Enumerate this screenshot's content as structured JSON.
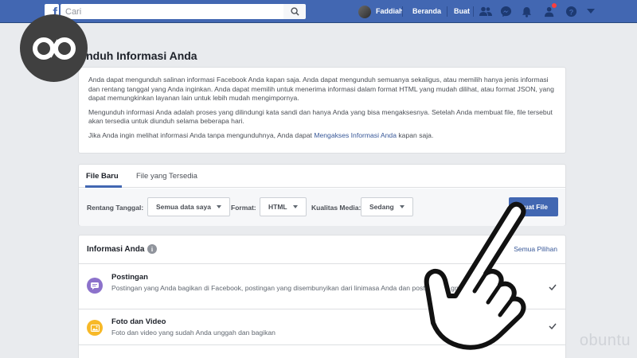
{
  "topbar": {
    "logo_letter": "f",
    "search_placeholder": "Cari",
    "user_name": "Faddiah",
    "home_label": "Beranda",
    "create_label": "Buat"
  },
  "watermark": {
    "text": "obuntu"
  },
  "page": {
    "title": "Unduh Informasi Anda"
  },
  "intro": {
    "para1": "Anda dapat mengunduh salinan informasi Facebook Anda kapan saja. Anda dapat mengunduh semuanya sekaligus, atau memilih hanya jenis informasi dan rentang tanggal yang Anda inginkan. Anda dapat memilih untuk menerima informasi dalam format HTML yang mudah dilihat, atau format JSON, yang dapat memungkinkan layanan lain untuk lebih mudah mengimpornya.",
    "para2": "Mengunduh informasi Anda adalah proses yang dilindungi kata sandi dan hanya Anda yang bisa mengaksesnya. Setelah Anda membuat file, file tersebut akan tersedia untuk diunduh selama beberapa hari.",
    "para3_before": "Jika Anda ingin melihat informasi Anda tanpa mengunduhnya, Anda dapat ",
    "para3_link": "Mengakses Informasi Anda",
    "para3_after": " kapan saja."
  },
  "tabs": [
    {
      "label": "File Baru",
      "active": true
    },
    {
      "label": "File yang Tersedia",
      "active": false
    }
  ],
  "options": {
    "date_range_label": "Rentang Tanggal:",
    "date_range_value": "Semua data saya",
    "format_label": "Format:",
    "format_value": "HTML",
    "media_quality_label": "Kualitas Media:",
    "media_quality_value": "Sedang",
    "create_button": "Buat File"
  },
  "info_list": {
    "title": "Informasi Anda",
    "select_all": "Semua Pilihan",
    "items": [
      {
        "title": "Postingan",
        "description": "Postingan yang Anda bagikan di Facebook, postingan yang disembunyikan dari linimasa Anda dan postingan di grup yang Anda buat",
        "icon": "post-icon",
        "icon_color": "#8c72cb",
        "checked": true
      },
      {
        "title": "Foto dan Video",
        "description": "Foto dan video yang sudah Anda unggah dan bagikan",
        "icon": "photo-icon",
        "icon_color": "#f7b928",
        "checked": true
      }
    ]
  },
  "colors": {
    "brand": "#4267b2",
    "link": "#385898",
    "background": "#e9ebee"
  }
}
